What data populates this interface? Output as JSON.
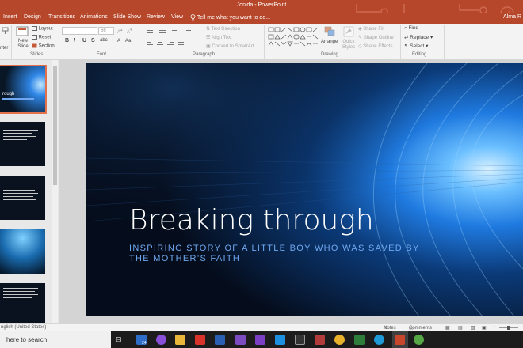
{
  "window": {
    "title": "Jonida  -  PowerPoint",
    "user": "Alma R"
  },
  "tabs": [
    "Insert",
    "Design",
    "Transitions",
    "Animations",
    "Slide Show",
    "Review",
    "View"
  ],
  "tell_me": "Tell me what you want to do...",
  "ribbon": {
    "groups": {
      "slides": "Slides",
      "font": "Font",
      "paragraph": "Paragraph",
      "drawing": "Drawing",
      "editing": "Editing"
    },
    "paste_fragment": "nter",
    "new_slide": "New Slide",
    "layout": "Layout",
    "reset": "Reset",
    "section": "Section",
    "font_size": "66",
    "text_direction": "Text Direction",
    "align_text": "Align Text",
    "convert_smartart": "Convert to SmartArt",
    "arrange": "Arrange",
    "quick_styles": "Quick Styles",
    "shape_fill": "Shape Fill",
    "shape_outline": "Shape Outline",
    "shape_effects": "Shape Effects",
    "find": "Find",
    "replace": "Replace",
    "select": "Select",
    "bold": "B",
    "italic": "I",
    "underline": "U",
    "strike": "S",
    "shadow": "abc"
  },
  "thumbnails": {
    "first_title": "rough"
  },
  "slide": {
    "title": "Breaking through",
    "subtitle": "INSPIRING STORY OF A LITTLE BOY WHO WAS SAVED BY THE MOTHER’S FAITH"
  },
  "status": {
    "language": "nglish (United States)",
    "notes": "Notes",
    "comments": "Comments"
  },
  "taskbar": {
    "search": "here to search",
    "mail_badge": "24"
  },
  "colors": {
    "accent": "#b7472a",
    "subtitle": "#6fa8f0"
  }
}
